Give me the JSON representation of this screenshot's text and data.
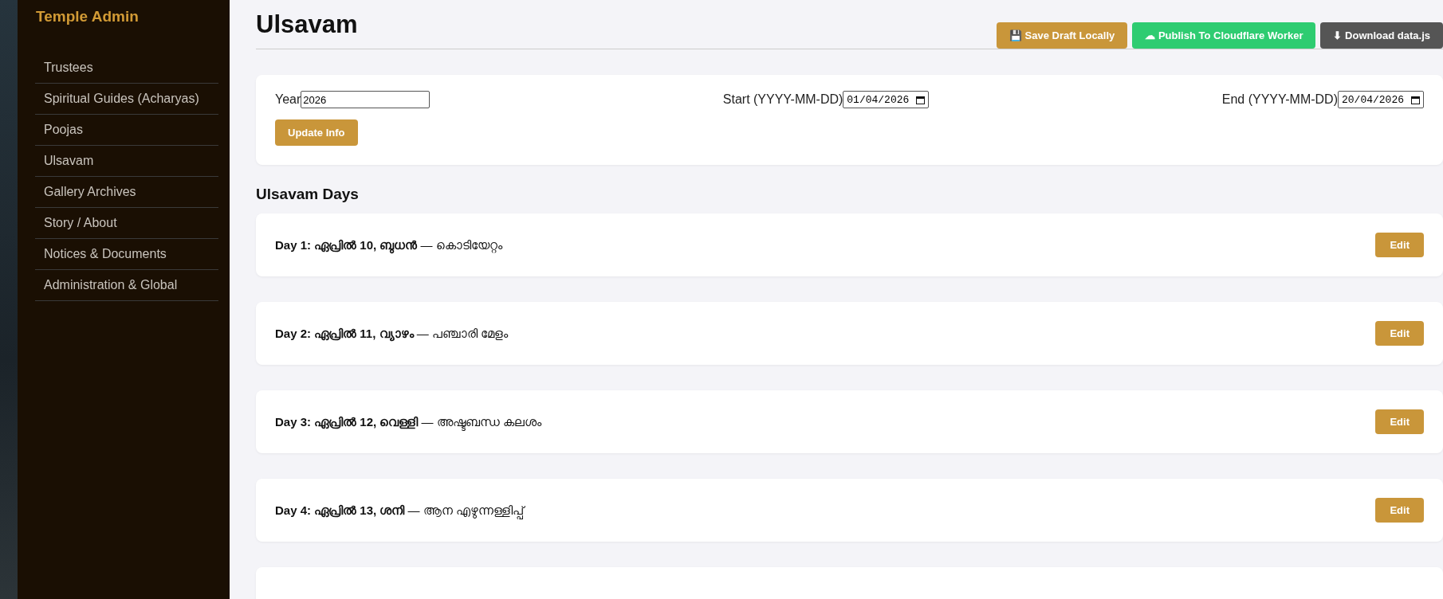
{
  "sidebar": {
    "title": "Temple Admin",
    "items": [
      {
        "label": "Trustees"
      },
      {
        "label": "Spiritual Guides (Acharyas)"
      },
      {
        "label": "Poojas"
      },
      {
        "label": "Ulsavam"
      },
      {
        "label": "Gallery Archives"
      },
      {
        "label": "Story / About"
      },
      {
        "label": "Notices & Documents"
      },
      {
        "label": "Administration & Global"
      }
    ]
  },
  "header": {
    "title": "Ulsavam",
    "buttons": [
      {
        "kind": "save",
        "icon": "💾",
        "label": "Save Draft Locally"
      },
      {
        "kind": "publish",
        "icon": "☁",
        "label": "Publish To Cloudflare Worker"
      },
      {
        "kind": "download",
        "icon": "⬇",
        "label": "Download data.js"
      }
    ]
  },
  "info": {
    "fields": [
      {
        "kind": "text",
        "label": "Year",
        "value": "2026"
      },
      {
        "kind": "date",
        "label": "Start (YYYY-MM-DD)",
        "value": "01/04/2026"
      },
      {
        "kind": "date",
        "label": "End (YYYY-MM-DD)",
        "value": "20/04/2026"
      }
    ],
    "button": "Update Info"
  },
  "days": {
    "title": "Ulsavam Days",
    "items": [
      {
        "text": "**Day 1: ഏപ്രിൽ 10, ബുധൻ** — കൊടിയേറ്റം",
        "button": "Edit"
      },
      {
        "text": "**Day 2: ഏപ്രിൽ 11, വ്യാഴം** — പഞ്ചാരി മേളം",
        "button": "Edit"
      },
      {
        "text": "**Day 3: ഏപ്രിൽ 12, വെള്ളി** — അഷ്ടബന്ധ കലശം",
        "button": "Edit"
      },
      {
        "text": "**Day 4: ഏപ്രിൽ 13, ശനി** — ആന എഴുന്നള്ളിപ്പ്",
        "button": "Edit"
      }
    ]
  }
}
